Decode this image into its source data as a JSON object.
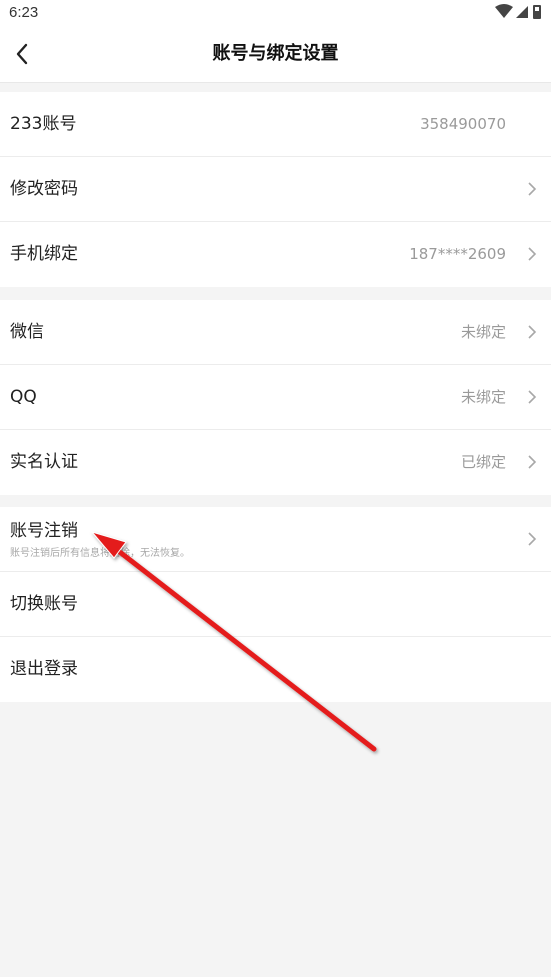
{
  "status": {
    "time": "6:23"
  },
  "nav": {
    "title": "账号与绑定设置"
  },
  "groups": [
    {
      "rows": [
        {
          "label": "233账号",
          "value": "358490070"
        },
        {
          "label": "修改密码",
          "value": ""
        },
        {
          "label": "手机绑定",
          "value": "187****2609"
        }
      ]
    },
    {
      "rows": [
        {
          "label": "微信",
          "value": "未绑定"
        },
        {
          "label": "QQ",
          "value": "未绑定"
        },
        {
          "label": "实名认证",
          "value": "已绑定"
        }
      ]
    },
    {
      "rows": [
        {
          "label": "账号注销",
          "sub": "账号注销后所有信息将删除，无法恢复。"
        },
        {
          "label": "切换账号"
        },
        {
          "label": "退出登录"
        }
      ]
    }
  ],
  "colors": {
    "background": "#f4f4f4",
    "annotation_arrow": "#e41e1e"
  }
}
